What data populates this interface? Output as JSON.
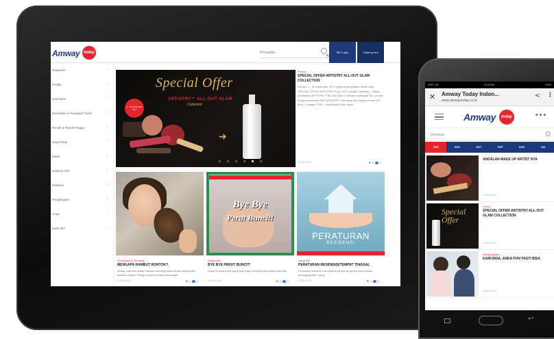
{
  "tablet": {
    "header": {
      "logo": "Amway",
      "badge": "today",
      "search_placeholder": "Pencarian",
      "login_label": "IBO Login",
      "join_label": "Gabung Kini"
    },
    "sidebar": {
      "items": [
        {
          "label": "Terpopuler"
        },
        {
          "label": "Produk"
        },
        {
          "label": "Kesehatan"
        },
        {
          "label": "Kecantikan & Perawatan Tubuh"
        },
        {
          "label": "Rumah & Rumah Tangga"
        },
        {
          "label": "Gaya Hidup"
        },
        {
          "label": "Bisnis"
        },
        {
          "label": "Sosial & CSR"
        },
        {
          "label": "Pelatihan"
        },
        {
          "label": "Penghargaan"
        },
        {
          "label": "Acara"
        },
        {
          "label": "Kisah IBO"
        }
      ]
    },
    "hero": {
      "title": "Special Offer",
      "subtitle": "ARTISTRY™ ALL-OUT GLAM",
      "subtitle2": "Collection",
      "circle_text": "1 - 31 Desember 2017",
      "dots": [
        false,
        false,
        false,
        false,
        true,
        false
      ]
    },
    "feature": {
      "category": "Promo",
      "title": "SPECIAL OFFER ARTISTRY ALL-OUT GLAM COLLECTION",
      "excerpt": "Berlaku 1 - 31 Desember 2017 (selama persediaan masih ada) SPECIAL OFFER ARTISTRY™ ALL-OUT GLAM Collection - Setiap pembelian ARTISTRY™ All-Out Glam Collection sebanyak Rp 1,5 juta (harga konsumen IBO) ARTISTRY Cleansing Gel (harga normal 537 ribu) * Tunggu PVBV - Download eFlyer disini",
      "date": "01 DES 2017",
      "likes": "0",
      "comments": "0"
    },
    "cards": [
      {
        "category": "Kecantikan & Perawat...",
        "title": "MENGAPA RAMBUT RONTOK?",
        "excerpt": "Setiap manusia setiap harinya memang berhenti dan kehilangan helaian rambut. Setiap manusia setiap kehilangan",
        "date": "01 DES 2017",
        "likes": "0",
        "comments": "0"
      },
      {
        "category": "Kesehatan",
        "title": "BYE BYE PERUT BUNCIT!",
        "excerpt": "Siapa di antara kita yang tidak ingin memiliki perut datar dan rata",
        "date": "04 DES 2017",
        "likes": "0",
        "comments": "0",
        "image_text_1": "Bye Bye",
        "image_text_2": "Perut Buncit!"
      },
      {
        "category": "Kisah IBO",
        "title": "PERATURAN RESIDENSI/TEMPAT TINGGAL",
        "excerpt": "Peraturan residensi merupakan peraturan global untuk bisnis pemegang IBO, yang",
        "date": "01 DES 2017",
        "likes": "0",
        "comments": "0",
        "image_text_1": "PERATURAN",
        "image_text_2": "RESIDENSI"
      }
    ]
  },
  "phone": {
    "status": {
      "left": "AT&T LTE",
      "clock": "12:00 AM",
      "right": "100%"
    },
    "urlbar": {
      "close": "✕",
      "title": "Amway Today Indon...",
      "url": "www.amwaytoday.co.id",
      "share": "<",
      "more": "⋮"
    },
    "header": {
      "logo": "Amway",
      "badge": "today",
      "dots": "•••"
    },
    "search_placeholder": "Pencarian",
    "tabs": [
      "DES",
      "NOV",
      "OKT",
      "SEP",
      "AGU",
      "JUL"
    ],
    "active_tab": 0,
    "items": [
      {
        "category": "",
        "title": "ANDALAN MAKE UP ARTIST NYA",
        "date": "01 DES 2017"
      },
      {
        "category": "Promo",
        "title": "SPECIAL OFFER ARTISTRY ALL-OUT GLAM COLLECTION",
        "date": "01 DES 2017",
        "thumb_text": "Special Offer"
      },
      {
        "category": "Penghargaan",
        "title": "KAMI BISA, ANDA PUN PASTI BISA",
        "date": "01 DES 2017"
      }
    ]
  },
  "colors": {
    "brand_blue": "#1f3a7a",
    "accent_red": "#e2262d",
    "gold": "#d6b35c"
  }
}
